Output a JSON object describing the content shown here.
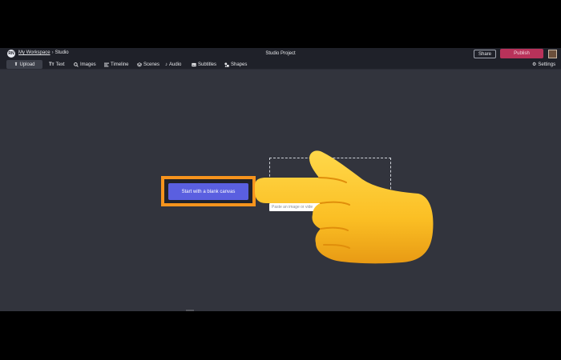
{
  "header": {
    "workspace_avatar": "RN",
    "workspace_link": "My Workspace",
    "separator": "›",
    "current_page": "Studio",
    "project_title": "Studio Project",
    "share_label": "Share",
    "publish_label": "Publish"
  },
  "toolbar": {
    "items": [
      {
        "label": "Upload",
        "icon": "upload-icon"
      },
      {
        "label": "Text",
        "icon": "text-icon"
      },
      {
        "label": "Images",
        "icon": "search-icon"
      },
      {
        "label": "Timeline",
        "icon": "timeline-icon"
      },
      {
        "label": "Scenes",
        "icon": "layers-icon"
      },
      {
        "label": "Audio",
        "icon": "music-note-icon"
      },
      {
        "label": "Subtitles",
        "icon": "subtitles-icon"
      },
      {
        "label": "Shapes",
        "icon": "shapes-icon"
      }
    ],
    "settings_label": "Settings"
  },
  "main": {
    "blank_canvas_label": "Start with a blank canvas",
    "dropzone_title": "Cli",
    "dropzone_subtitle": "or, drag and",
    "url_placeholder": "Paste an image or vide"
  },
  "colors": {
    "background": "#32343d",
    "topbar": "#1f2129",
    "accent": "#5a5fe0",
    "publish": "#b8325a",
    "highlight": "#f7941d"
  },
  "overlay": {
    "icon": "pointing-hand-icon"
  }
}
